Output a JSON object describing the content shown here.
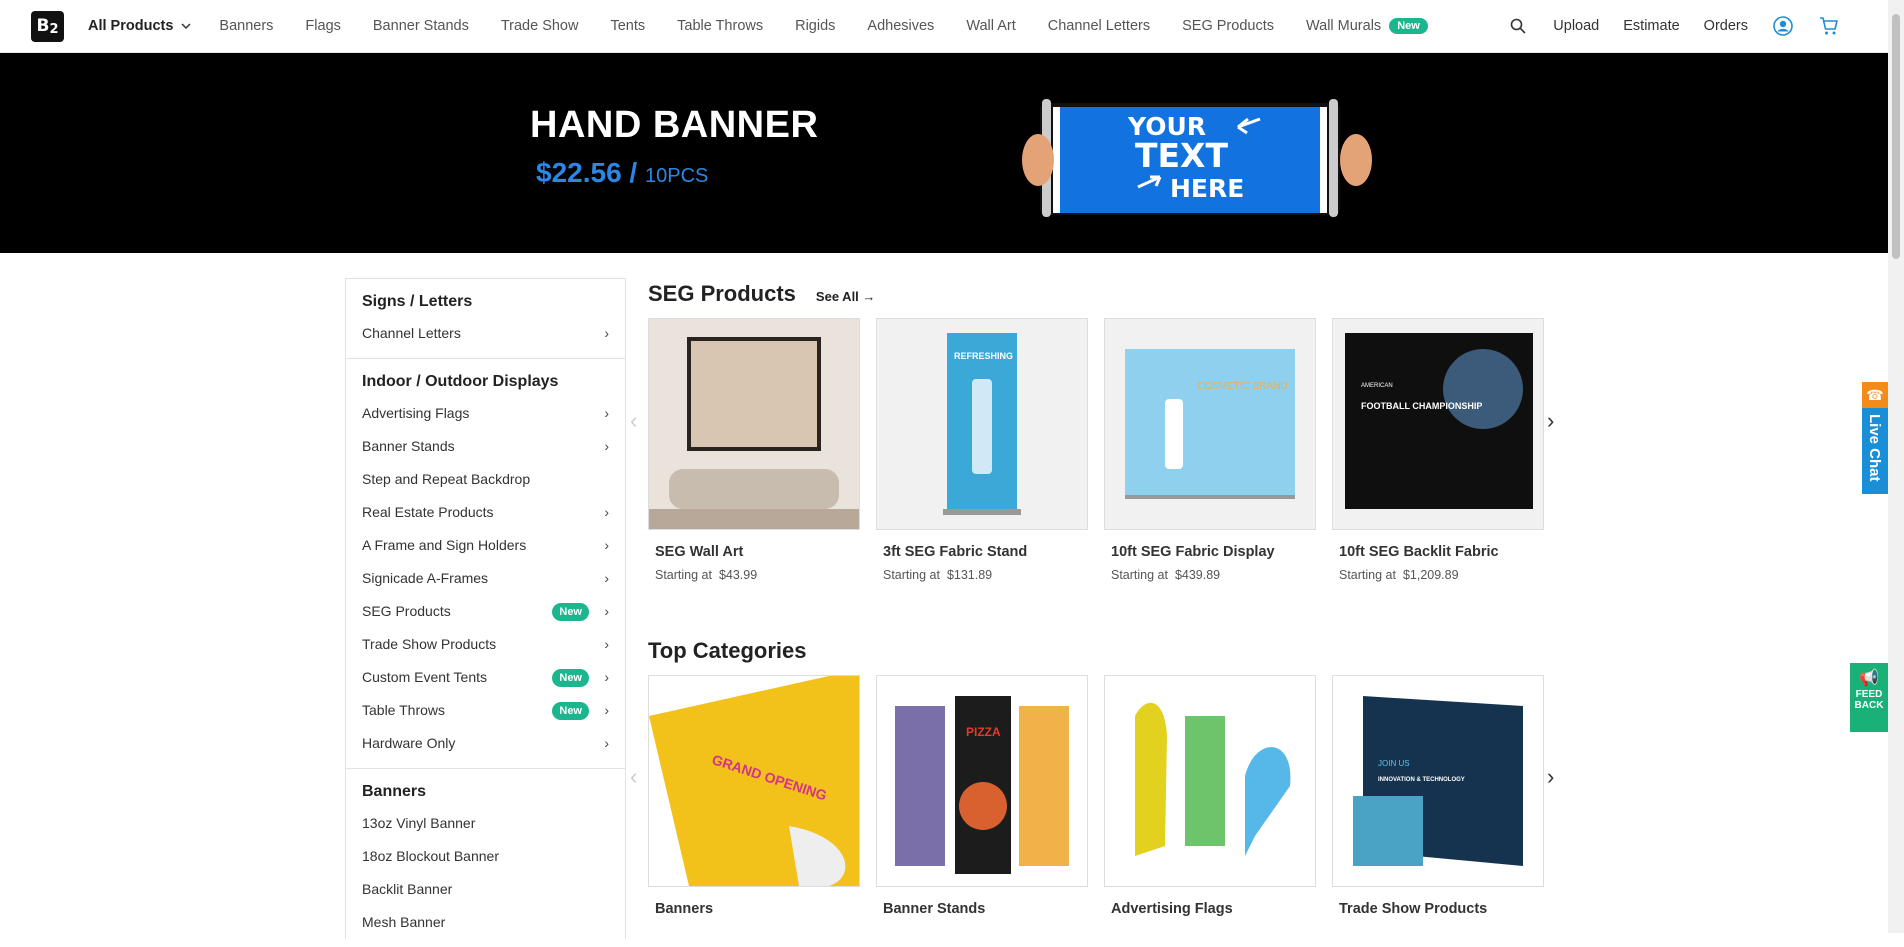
{
  "header": {
    "logo_text": "B",
    "logo_sub": "2",
    "nav": [
      "All Products",
      "Banners",
      "Flags",
      "Banner Stands",
      "Trade Show",
      "Tents",
      "Table Throws",
      "Rigids",
      "Adhesives",
      "Wall Art",
      "Channel Letters",
      "SEG Products",
      "Wall Murals"
    ],
    "nav_badge": "New",
    "upload": "Upload",
    "estimate": "Estimate",
    "orders": "Orders",
    "icons": [
      "search-icon",
      "account-icon",
      "cart-icon"
    ]
  },
  "hero": {
    "title": "HAND BANNER",
    "price": "$22.56 /",
    "qty": "10PCS",
    "banner_line1": "YOUR",
    "banner_line2": "TEXT",
    "banner_line3": "HERE"
  },
  "sidebar": {
    "sections": [
      {
        "title": "Signs / Letters",
        "items": [
          {
            "label": "Channel Letters",
            "chevron": true
          }
        ]
      },
      {
        "title": "Indoor / Outdoor Displays",
        "items": [
          {
            "label": "Advertising Flags",
            "chevron": true
          },
          {
            "label": "Banner Stands",
            "chevron": true
          },
          {
            "label": "Step and Repeat Backdrop",
            "chevron": false
          },
          {
            "label": "Real Estate Products",
            "chevron": true
          },
          {
            "label": "A Frame and Sign Holders",
            "chevron": true
          },
          {
            "label": "Signicade A-Frames",
            "chevron": true
          },
          {
            "label": "SEG Products",
            "chevron": true,
            "badge": "New"
          },
          {
            "label": "Trade Show Products",
            "chevron": true
          },
          {
            "label": "Custom Event Tents",
            "chevron": true,
            "badge": "New"
          },
          {
            "label": "Table Throws",
            "chevron": true,
            "badge": "New"
          },
          {
            "label": "Hardware Only",
            "chevron": true
          }
        ]
      },
      {
        "title": "Banners",
        "items": [
          {
            "label": "13oz Vinyl Banner",
            "chevron": false
          },
          {
            "label": "18oz Blockout Banner",
            "chevron": false
          },
          {
            "label": "Backlit Banner",
            "chevron": false
          },
          {
            "label": "Mesh Banner",
            "chevron": false
          }
        ]
      }
    ]
  },
  "seg": {
    "title": "SEG Products",
    "see_all": "See All",
    "price_prefix": "Starting at",
    "cards": [
      {
        "name": "SEG Wall Art",
        "price": "$43.99"
      },
      {
        "name": "3ft SEG Fabric Stand",
        "price": "$131.89",
        "thumb_text": "REFRESHING"
      },
      {
        "name": "10ft SEG Fabric Display",
        "price": "$439.89",
        "thumb_text": "COSMETIC BRAND"
      },
      {
        "name": "10ft SEG Backlit Fabric",
        "price": "$1,209.89",
        "thumb_text": "FOOTBALL CHAMPIONSHIP",
        "thumb_text_small": "AMERICAN"
      }
    ]
  },
  "top": {
    "title": "Top Categories",
    "cards": [
      {
        "name": "Banners",
        "thumb_text": "GRAND OPENING"
      },
      {
        "name": "Banner Stands",
        "thumb_text": "PIZZA"
      },
      {
        "name": "Advertising Flags"
      },
      {
        "name": "Trade Show Products",
        "thumb_text": "INNOVATION & TECHNOLOGY",
        "thumb_text_small": "JOIN US"
      }
    ]
  },
  "floating": {
    "live_chat": "Live Chat",
    "feedback_line1": "FEED",
    "feedback_line2": "BACK"
  },
  "colors": {
    "accent_green": "#1bb58e",
    "hero_bg": "#000000",
    "price_blue": "#2a87e5",
    "chat_blue": "#1a8fd8",
    "chat_orange": "#f28b1a"
  }
}
